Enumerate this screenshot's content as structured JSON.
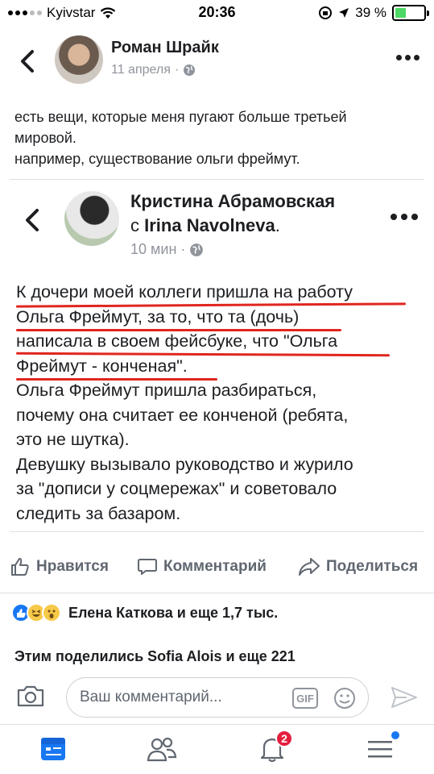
{
  "status_bar": {
    "carrier": "Kyivstar",
    "time": "20:36",
    "battery": "39 %",
    "battery_level": 0.39
  },
  "post": {
    "author": "Роман Шрайк",
    "date": "11 апреля",
    "text_lines": [
      "есть вещи, которые меня пугают больше третьей",
      "мировой.",
      "например, существование ольги фреймут."
    ]
  },
  "shared_post": {
    "author": "Кристина Абрамовская",
    "with_prefix": "с",
    "with_name": "Irina Navolneva",
    "with_suffix": ".",
    "time": "10 мин",
    "text_lines": [
      "К дочери моей коллеги пришла на работу",
      "Ольга Фреймут, за то, что та (дочь)",
      "написала в своем фейсбуке, что \"Ольга",
      "Фреймут - конченая\".",
      "Ольга Фреймут пришла разбираться,",
      "почему она считает ее конченой (ребята,",
      "это не шутка).",
      "Девушку вызывало руководство и журило",
      "за \"дописи у соцмережах\" и советовало",
      "следить за базаром."
    ]
  },
  "actions": {
    "like": "Нравится",
    "comment": "Комментарий",
    "share": "Поделиться"
  },
  "reactions": {
    "text": "Елена Каткова и еще 1,7 тыс."
  },
  "shares": {
    "text": "Этим поделились Sofia Alois и еще 221"
  },
  "comment_bar": {
    "placeholder": "Ваш комментарий...",
    "gif_label": "GIF"
  },
  "tab_bar": {
    "notifications_badge": "2"
  },
  "colors": {
    "accent": "#1877f2",
    "underline": "#e0261f",
    "badge": "#e41e3f"
  }
}
